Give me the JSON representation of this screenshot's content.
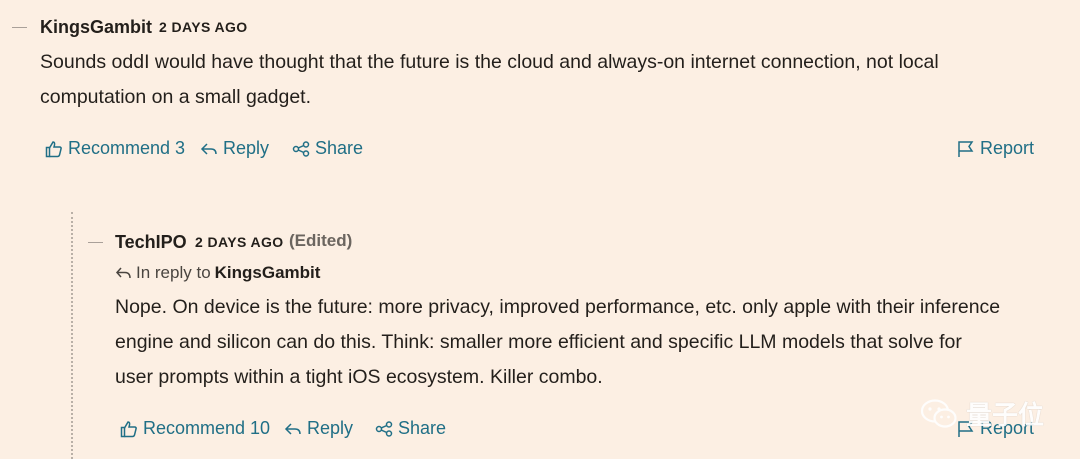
{
  "comment1": {
    "author": "KingsGambit",
    "time": "2 DAYS AGO",
    "body_line1": "Sounds oddI would have thought that the future is the cloud and always-on internet connection, not local",
    "body_line2": "computation on a small gadget.",
    "actions": {
      "recommend": "Recommend 3",
      "reply": "Reply",
      "share": "Share",
      "report": "Report"
    }
  },
  "comment2": {
    "author": "TechIPO",
    "time": "2 DAYS AGO",
    "edited": "(Edited)",
    "in_reply_prefix": "In reply to",
    "in_reply_author": "KingsGambit",
    "body_line1": "Nope. On device is the future: more privacy, improved performance, etc. only apple with their inference",
    "body_line2": "engine and silicon can do this. Think: smaller more efficient and specific LLM models that solve for",
    "body_line3": "user prompts within a tight iOS ecosystem. Killer combo.",
    "actions": {
      "recommend": "Recommend 10",
      "reply": "Reply",
      "share": "Share",
      "report": "Report"
    }
  },
  "watermark": {
    "text": "量子位"
  },
  "colors": {
    "background": "#fcefe3",
    "link": "#206f86",
    "text": "#231f1b"
  },
  "icons": [
    "thumbs-up-icon",
    "reply-arrow-icon",
    "share-icon",
    "flag-icon"
  ]
}
